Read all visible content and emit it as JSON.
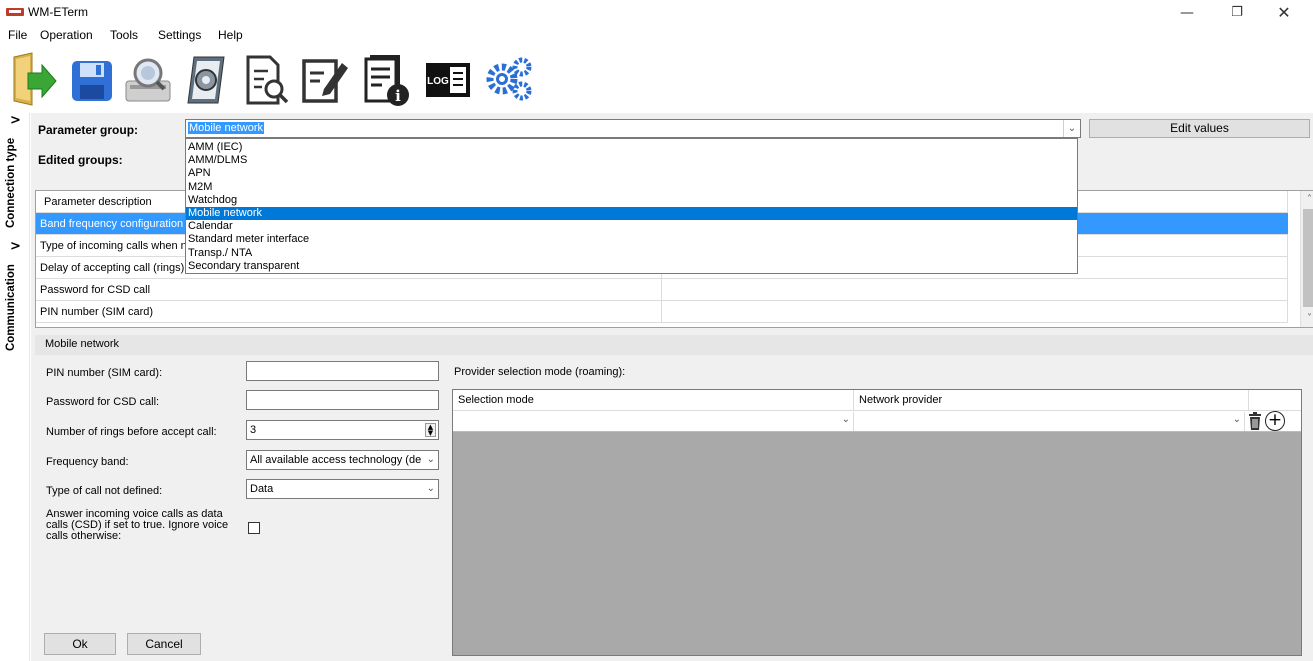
{
  "window": {
    "title": "WM-ETerm",
    "minimize": "—",
    "maximize": "❐",
    "close": "✕"
  },
  "menu": [
    {
      "label": "File"
    },
    {
      "label": "Operation"
    },
    {
      "label": "Tools"
    },
    {
      "label": "Settings"
    },
    {
      "label": "Help"
    }
  ],
  "toolbar": {
    "icons": [
      "open-folder-icon",
      "save-icon",
      "search-device-icon",
      "firmware-icon",
      "document-preview-icon",
      "edit-document-icon",
      "document-info-icon",
      "log-icon",
      "settings-gears-icon"
    ],
    "log_text": "LOG"
  },
  "sidebar": {
    "tabs": [
      {
        "label": "Connection type",
        "chevron": ">"
      },
      {
        "label": "Communication",
        "chevron": ">"
      }
    ]
  },
  "params": {
    "group_label": "Parameter group:",
    "group_value": "Mobile network",
    "edited_label": "Edited groups:",
    "edit_button": "Edit values"
  },
  "dropdown": {
    "options": [
      "AMM (IEC)",
      "AMM/DLMS",
      "APN",
      "M2M",
      "Watchdog",
      "Mobile network",
      "Calendar",
      "Standard meter interface",
      "Transp./ NTA",
      "Secondary transparent"
    ],
    "selected_index": 5
  },
  "grid": {
    "header": "Parameter description",
    "rows": [
      "Band frequency configuration",
      "Type of incoming calls when n",
      "Delay of accepting call (rings)",
      "Password for CSD call",
      "PIN number (SIM card)"
    ]
  },
  "mobile": {
    "title": "Mobile network",
    "pin_label": "PIN number (SIM card):",
    "pin_value": "",
    "password_label": "Password for CSD call:",
    "password_value": "",
    "rings_label": "Number of rings before accept call:",
    "rings_value": "3",
    "band_label": "Frequency band:",
    "band_value": "All available access technology (de",
    "calltype_label": "Type of call not defined:",
    "calltype_value": "Data",
    "answer_label": "Answer incoming voice calls as data calls (CSD) if set to true. Ignore voice calls otherwise:",
    "answer_checked": false,
    "ok_button": "Ok",
    "cancel_button": "Cancel"
  },
  "provider": {
    "label": "Provider selection mode (roaming):",
    "col_mode": "Selection mode",
    "col_provider": "Network provider",
    "row_mode": "",
    "row_provider": ""
  }
}
